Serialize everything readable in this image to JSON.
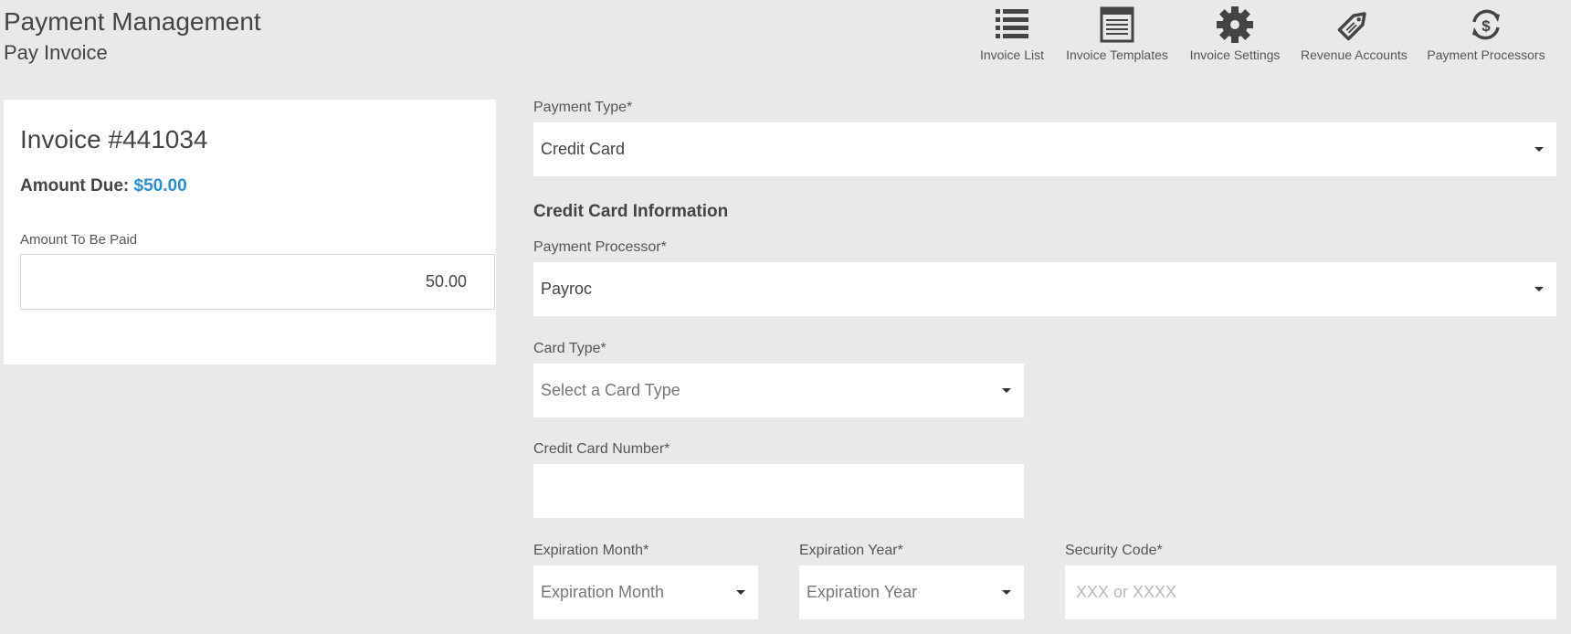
{
  "header": {
    "title": "Payment Management",
    "subtitle": "Pay Invoice"
  },
  "toolbar": {
    "items": [
      {
        "label": "Invoice List",
        "icon": "list-icon"
      },
      {
        "label": "Invoice Templates",
        "icon": "template-icon"
      },
      {
        "label": "Invoice Settings",
        "icon": "gear-icon"
      },
      {
        "label": "Revenue Accounts",
        "icon": "tag-icon"
      },
      {
        "label": "Payment Processors",
        "icon": "refresh-dollar-icon"
      }
    ]
  },
  "invoice": {
    "number": "Invoice #441034",
    "amount_due_label": "Amount Due:",
    "amount_due_value": "$50.00",
    "amount_to_pay_label": "Amount To Be Paid",
    "amount_to_pay_value": "50.00"
  },
  "form": {
    "payment_type": {
      "label": "Payment Type*",
      "value": "Credit Card"
    },
    "section_heading": "Credit Card Information",
    "payment_processor": {
      "label": "Payment Processor*",
      "value": "Payroc"
    },
    "card_type": {
      "label": "Card Type*",
      "placeholder": "Select a Card Type"
    },
    "card_number": {
      "label": "Credit Card Number*",
      "value": ""
    },
    "exp_month": {
      "label": "Expiration Month*",
      "placeholder": "Expiration Month"
    },
    "exp_year": {
      "label": "Expiration Year*",
      "placeholder": "Expiration Year"
    },
    "security_code": {
      "label": "Security Code*",
      "placeholder": "XXX or XXXX"
    }
  },
  "colors": {
    "accent": "#2c8fd6",
    "background": "#e8e9eb",
    "icon": "#444444"
  }
}
